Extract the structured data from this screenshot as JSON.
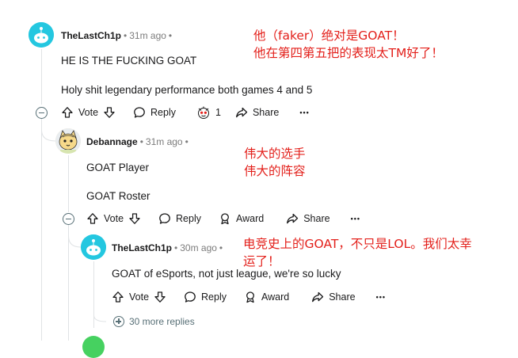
{
  "comments": [
    {
      "username": "TheLastCh1p",
      "time": "31m ago",
      "dot": "•",
      "lines": [
        "HE IS THE FUCKING GOAT",
        "Holy shit legendary performance both games 4 and 5"
      ],
      "actions": {
        "vote": "Vote",
        "reply": "Reply",
        "award_count": "1",
        "share": "Share",
        "more": "•••"
      }
    },
    {
      "username": "Debannage",
      "time": "31m ago",
      "dot": "•",
      "lines": [
        "GOAT Player",
        "GOAT Roster"
      ],
      "actions": {
        "vote": "Vote",
        "reply": "Reply",
        "award": "Award",
        "share": "Share",
        "more": "•••"
      }
    },
    {
      "username": "TheLastCh1p",
      "time": "30m ago",
      "dot": "•",
      "lines": [
        "GOAT of eSports, not just league, we're so lucky"
      ],
      "actions": {
        "vote": "Vote",
        "reply": "Reply",
        "award": "Award",
        "share": "Share",
        "more": "•••"
      },
      "more_replies": "30 more replies"
    }
  ],
  "annotations": {
    "a1": [
      "他（faker）绝对是GOAT！",
      "他在第四第五把的表现太TM好了！"
    ],
    "a2": [
      "伟大的选手",
      "伟大的阵容"
    ],
    "a3": [
      "电竞史上的GOAT，不只是LOL。我们太幸",
      "运了！"
    ]
  },
  "colors": {
    "annotation": "#e3201b",
    "avatar_blue": "#24c7e0",
    "thread_line": "#e0e3e5",
    "meta_gray": "#7c7c7c"
  },
  "icons": [
    "upvote-icon",
    "downvote-icon",
    "reply-icon",
    "award-icon",
    "share-icon",
    "snoo-avatar-icon"
  ]
}
